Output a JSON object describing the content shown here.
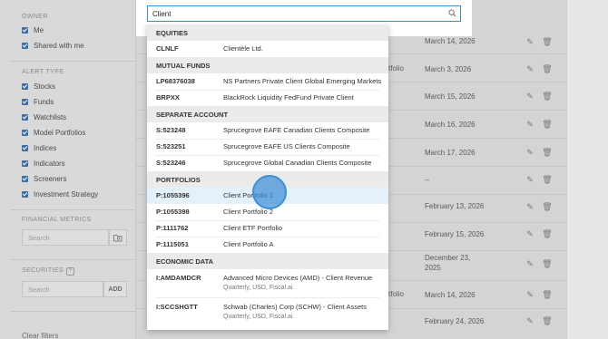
{
  "sidebar": {
    "owner_title": "OWNER",
    "owner_items": [
      "Me",
      "Shared with me"
    ],
    "alert_type_title": "ALERT TYPE",
    "alert_types": [
      "Stocks",
      "Funds",
      "Watchlists",
      "Model Portfolios",
      "Indices",
      "Indicators",
      "Screeners",
      "Investment Strategy"
    ],
    "financial_metrics_title": "FINANCIAL METRICS",
    "financial_metrics_placeholder": "Search",
    "securities_title": "SECURITIES",
    "securities_badge": "?",
    "securities_placeholder": "Search",
    "securities_add": "ADD",
    "clear_filters": "Clear filters"
  },
  "search": {
    "value": "Client"
  },
  "dropdown": {
    "groups": [
      {
        "title": "EQUITIES",
        "items": [
          {
            "symbol": "CLNLF",
            "name": "Clientèle Ltd."
          }
        ]
      },
      {
        "title": "MUTUAL FUNDS",
        "items": [
          {
            "symbol": "LP68376038",
            "name": "NS Partners Private Client Global Emerging Markets"
          },
          {
            "symbol": "BRPXX",
            "name": "BlackRock Liquidity FedFund Private Client"
          }
        ]
      },
      {
        "title": "SEPARATE ACCOUNT",
        "items": [
          {
            "symbol": "S:523248",
            "name": "Sprucegrove EAFE Canadian Clients Composite"
          },
          {
            "symbol": "S:523251",
            "name": "Sprucegrove EAFE US Clients Composite"
          },
          {
            "symbol": "S:523246",
            "name": "Sprucegrove Global Canadian Clients Composite"
          }
        ]
      },
      {
        "title": "PORTFOLIOS",
        "items": [
          {
            "symbol": "P:1055396",
            "name": "Client Portfolio 1"
          },
          {
            "symbol": "P:1055398",
            "name": "Client Portfolio 2"
          },
          {
            "symbol": "P:1111762",
            "name": "Client ETF Portfolio"
          },
          {
            "symbol": "P:1115051",
            "name": "Client Portfolio A"
          }
        ]
      },
      {
        "title": "ECONOMIC DATA",
        "items": [
          {
            "symbol": "I:AMDAMDCR",
            "name": "Advanced Micro Devices (AMD) - Client Revenue",
            "sub": "Quarterly, USD, Fiscal.ai"
          },
          {
            "symbol": "I:SCCSHGTT",
            "name": "Schwab (Charles) Corp (SCHW) - Client Assets",
            "sub": "Quarterly, USD, Fiscal.ai"
          }
        ]
      }
    ]
  },
  "table": {
    "dates": [
      "March 14, 2026",
      "March 3, 2026",
      "March 15, 2026",
      "March 16, 2026",
      "March 17, 2026",
      "--",
      "February 13, 2026",
      "February 15, 2026",
      "December 23,",
      "2025",
      "March 14, 2026",
      "February 24, 2026"
    ],
    "partial_labels": [
      "tfolio",
      "tfolio"
    ]
  },
  "icons": {
    "edit": "pencil-icon",
    "delete": "trash-icon",
    "search": "search-icon",
    "folder": "folder-search-icon"
  },
  "colors": {
    "accent": "#3a8fd6",
    "checkbox": "#3a6ea5",
    "highlight": "#e4f0fa"
  }
}
